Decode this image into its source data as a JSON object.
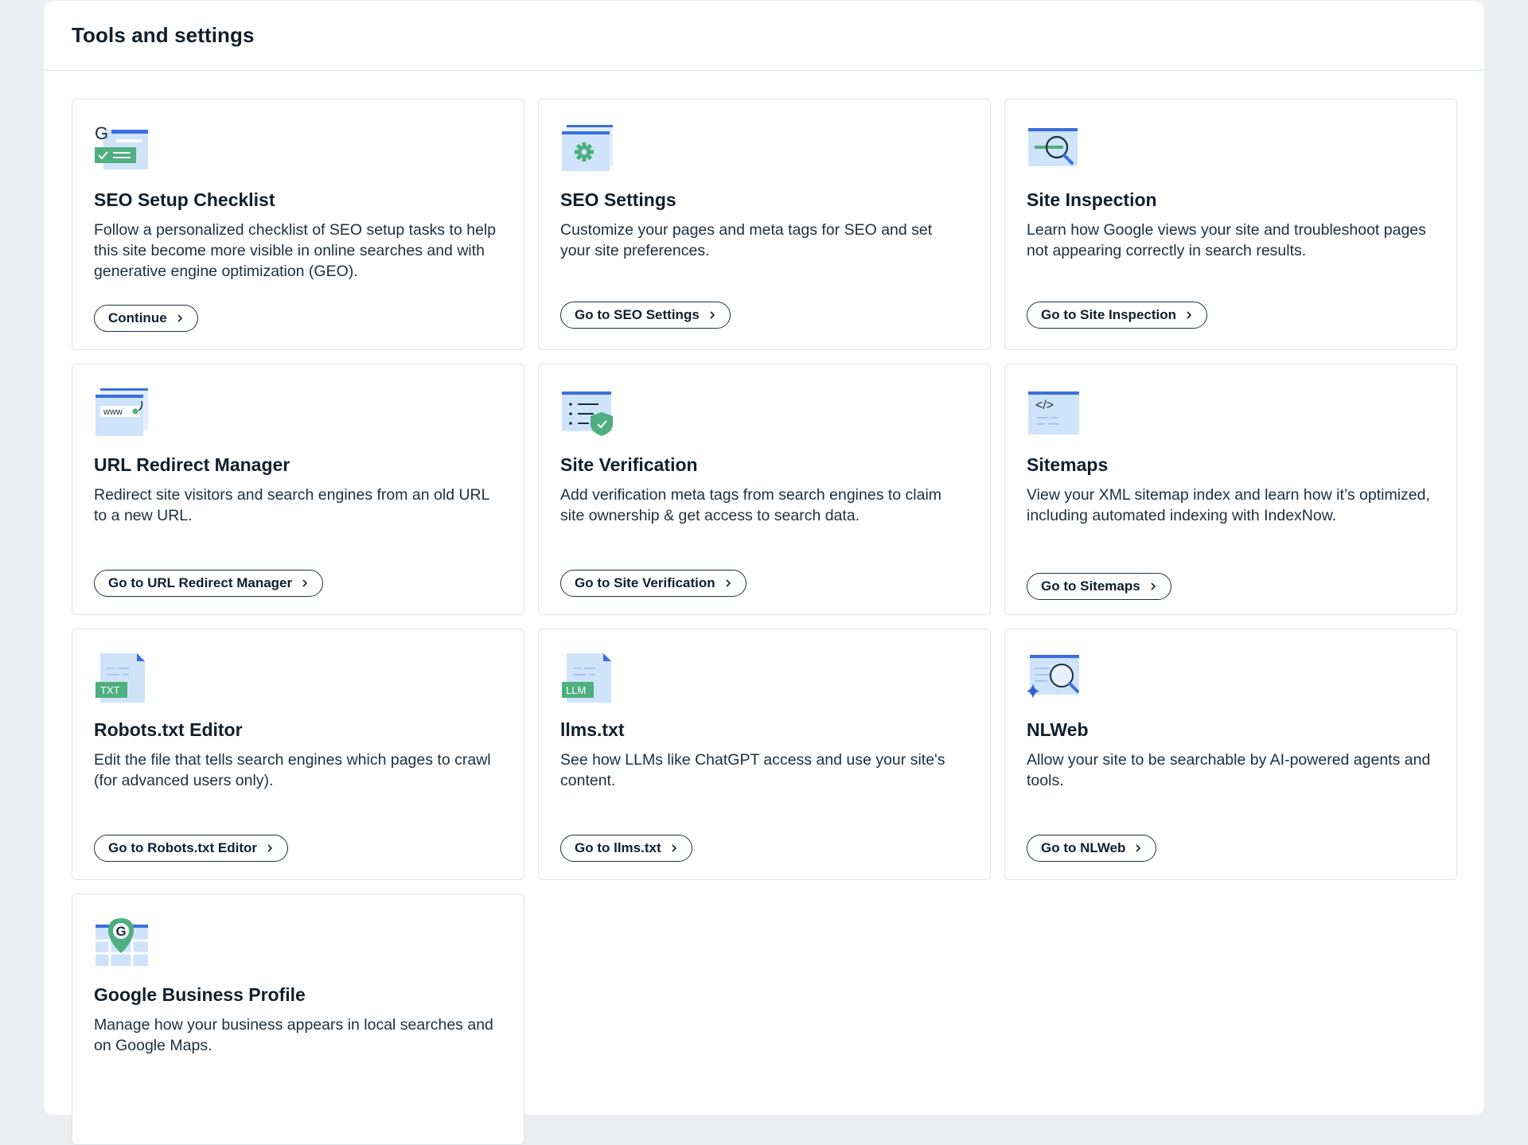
{
  "page": {
    "title": "Tools and settings"
  },
  "cards": [
    {
      "title": "SEO Setup Checklist",
      "description": "Follow a personalized checklist of SEO setup tasks to help this site become more visible in online searches and with generative engine optimization (GEO).",
      "button": "Continue",
      "icon": "seo-checklist-icon",
      "icon_text": "G"
    },
    {
      "title": "SEO Settings",
      "description": "Customize your pages and meta tags for SEO and set your site preferences.",
      "button": "Go to SEO Settings",
      "icon": "seo-settings-gear-icon"
    },
    {
      "title": "Site Inspection",
      "description": "Learn how Google views your site and troubleshoot pages not appearing correctly in search results.",
      "button": "Go to Site Inspection",
      "icon": "site-inspection-magnifier-icon"
    },
    {
      "title": "URL Redirect Manager",
      "description": "Redirect site visitors and search engines from an old URL to a new URL.",
      "button": "Go to URL Redirect Manager",
      "icon": "url-redirect-icon",
      "icon_text": "www"
    },
    {
      "title": "Site Verification",
      "description": "Add verification meta tags from search engines to claim site ownership & get access to search data.",
      "button": "Go to Site Verification",
      "icon": "site-verification-shield-icon"
    },
    {
      "title": "Sitemaps",
      "description": "View your XML sitemap index and learn how it’s optimized, including automated indexing with IndexNow.",
      "button": "Go to Sitemaps",
      "icon": "sitemaps-code-icon",
      "icon_text": "</>"
    },
    {
      "title": "Robots.txt Editor",
      "description": "Edit the file that tells search engines which pages to crawl (for advanced users only).",
      "button": "Go to Robots.txt Editor",
      "icon": "txt-file-icon",
      "icon_text": "TXT"
    },
    {
      "title": "llms.txt",
      "description": "See how LLMs like ChatGPT access and use your site's content.",
      "button": "Go to llms.txt",
      "icon": "llm-file-icon",
      "icon_text": "LLM"
    },
    {
      "title": "NLWeb",
      "description": "Allow your site to be searchable by AI-powered agents and tools.",
      "button": "Go to NLWeb",
      "icon": "nlweb-search-sparkle-icon"
    },
    {
      "title": "Google Business Profile",
      "description": "Manage how your business appears in local searches and on Google Maps.",
      "button": "",
      "icon": "google-map-pin-icon",
      "icon_text": "G"
    }
  ],
  "colors": {
    "accent_blue": "#3b6fe0",
    "light_blue": "#cfe3fb",
    "green": "#4faf7f",
    "text": "#0f1f2e"
  }
}
